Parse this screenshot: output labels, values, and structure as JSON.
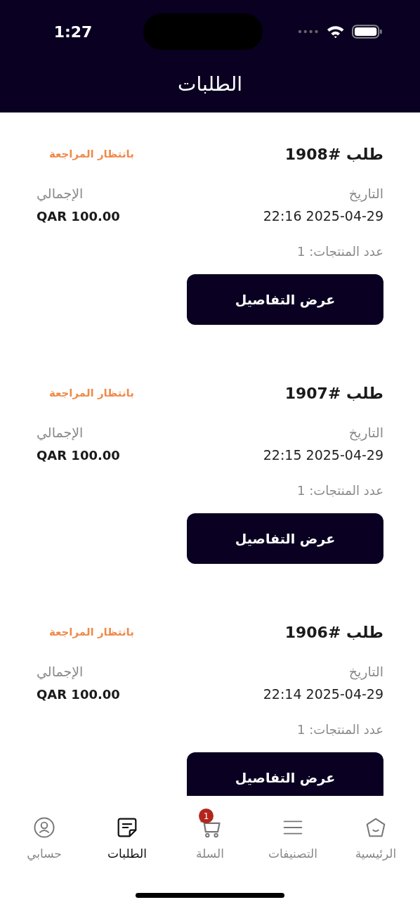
{
  "status_bar": {
    "time": "1:27"
  },
  "header": {
    "title": "الطلبات"
  },
  "orders": [
    {
      "title": "طلب #1908",
      "status": "بانتظار المراجعة",
      "date_label": "التاريخ",
      "date": "2025-04-29 22:16",
      "total_label": "الإجمالي",
      "total": "QAR 100.00",
      "items_count": "عدد المنتجات: 1",
      "button": "عرض التفاصيل"
    },
    {
      "title": "طلب #1907",
      "status": "بانتظار المراجعة",
      "date_label": "التاريخ",
      "date": "2025-04-29 22:15",
      "total_label": "الإجمالي",
      "total": "QAR 100.00",
      "items_count": "عدد المنتجات: 1",
      "button": "عرض التفاصيل"
    },
    {
      "title": "طلب #1906",
      "status": "بانتظار المراجعة",
      "date_label": "التاريخ",
      "date": "2025-04-29 22:14",
      "total_label": "الإجمالي",
      "total": "QAR 100.00",
      "items_count": "عدد المنتجات: 1",
      "button": "عرض التفاصيل"
    }
  ],
  "tab_bar": [
    {
      "kind": "home",
      "label": "الرئيسية",
      "selected": false
    },
    {
      "kind": "categories",
      "label": "التصنيفات",
      "selected": false
    },
    {
      "kind": "cart",
      "label": "السلة",
      "selected": false,
      "badge": "1"
    },
    {
      "kind": "orders",
      "label": "الطلبات",
      "selected": true
    },
    {
      "kind": "account",
      "label": "حسابي",
      "selected": false
    }
  ]
}
